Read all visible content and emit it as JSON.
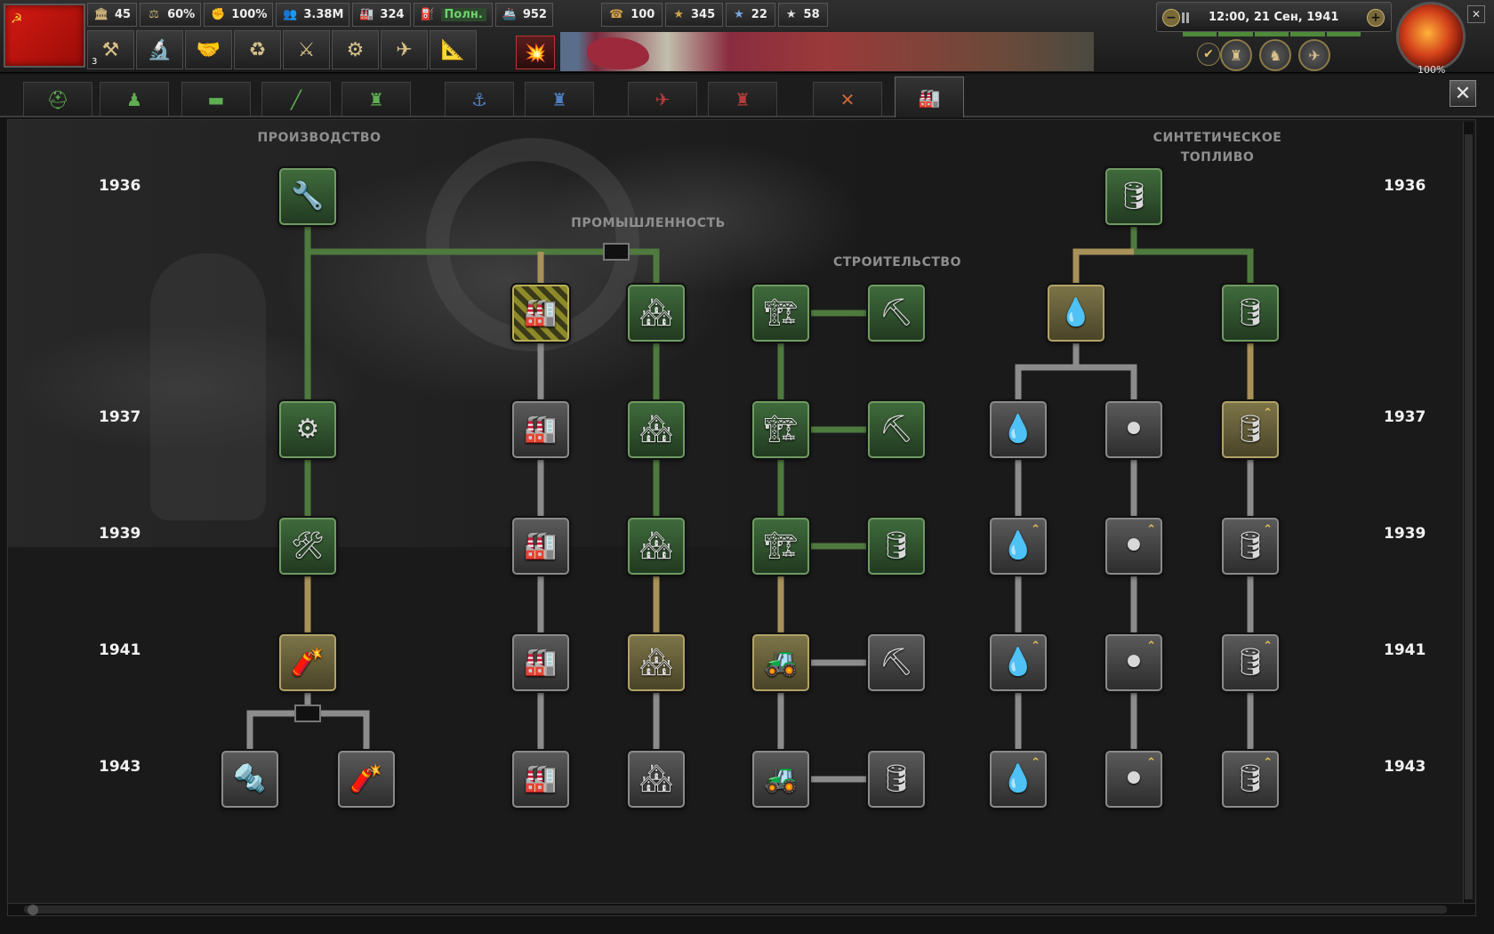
{
  "topbar": {
    "resources": [
      {
        "icon": "political-power-icon",
        "glyph": "🏛",
        "value": "45"
      },
      {
        "icon": "stability-icon",
        "glyph": "⚖",
        "value": "60%"
      },
      {
        "icon": "war-support-icon",
        "glyph": "✊",
        "value": "100%"
      },
      {
        "icon": "manpower-icon",
        "glyph": "👥",
        "value": "3.38M"
      },
      {
        "icon": "factories-icon",
        "glyph": "🏭",
        "value": "324"
      },
      {
        "icon": "fuel-icon",
        "glyph": "⛽",
        "value": "Полн."
      },
      {
        "icon": "convoys-icon",
        "glyph": "🚢",
        "value": "952"
      }
    ],
    "counters": [
      {
        "icon": "intel-icon",
        "glyph": "☎",
        "value": "100"
      },
      {
        "icon": "command-power-icon",
        "glyph": "★",
        "value": "345"
      },
      {
        "icon": "navy-xp-icon",
        "glyph": "★",
        "value": "22"
      },
      {
        "icon": "air-xp-icon",
        "glyph": "★",
        "value": "58"
      }
    ],
    "menu_buttons": [
      {
        "name": "decisions-button",
        "glyph": "⚒",
        "badge": "3"
      },
      {
        "name": "research-button",
        "glyph": "🔬",
        "badge": ""
      },
      {
        "name": "diplomacy-button",
        "glyph": "🤝",
        "badge": ""
      },
      {
        "name": "trade-button",
        "glyph": "♻",
        "badge": ""
      },
      {
        "name": "construction-button",
        "glyph": "⚔",
        "badge": ""
      },
      {
        "name": "production-button",
        "glyph": "⚙",
        "badge": ""
      },
      {
        "name": "logistics-button",
        "glyph": "✈",
        "badge": ""
      },
      {
        "name": "intelligence-button",
        "glyph": "📐",
        "badge": ""
      }
    ],
    "alert_glyph": "💥",
    "time": "12:00, 21 Сен, 1941",
    "speed_minus": "−",
    "speed_plus": "+",
    "round_buttons": [
      "♜",
      "♞",
      "✈"
    ],
    "check_glyph": "✔",
    "globe_label": "100%",
    "mini_close": "✕"
  },
  "tabs": [
    {
      "name": "tab-infantry",
      "glyph": "⛑",
      "color": "green",
      "active": false
    },
    {
      "name": "tab-support",
      "glyph": "♟",
      "color": "green",
      "active": false
    },
    {
      "name": "tab-armor",
      "glyph": "▬",
      "color": "green",
      "active": false
    },
    {
      "name": "tab-artillery",
      "glyph": "╱",
      "color": "green",
      "active": false
    },
    {
      "name": "tab-land-doctrine",
      "glyph": "♜",
      "color": "green",
      "active": false
    },
    {
      "name": "tab-naval",
      "glyph": "⚓",
      "color": "blue",
      "active": false
    },
    {
      "name": "tab-naval-doctrine",
      "glyph": "♜",
      "color": "blue",
      "active": false
    },
    {
      "name": "tab-air",
      "glyph": "✈",
      "color": "red",
      "active": false
    },
    {
      "name": "tab-air-doctrine",
      "glyph": "♜",
      "color": "red",
      "active": false
    },
    {
      "name": "tab-electronics",
      "glyph": "✕",
      "color": "orange",
      "active": false
    },
    {
      "name": "tab-industry",
      "glyph": "🏭",
      "color": "orange",
      "active": true
    }
  ],
  "close_label": "✕",
  "categories": {
    "production": "ПРОИЗВОДСТВО",
    "industry": "ПРОМЫШЛЕННОСТЬ",
    "construction": "СТРОИТЕЛЬСТВО",
    "synthetic_1": "СИНТЕТИЧЕСКОЕ",
    "synthetic_2": "ТОПЛИВО"
  },
  "years": {
    "y1936": "1936",
    "y1937": "1937",
    "y1939": "1939",
    "y1941": "1941",
    "y1943": "1943"
  },
  "tech_nodes": [
    {
      "id": "basic-machine-tools",
      "status": "researched",
      "glyph": "🔧"
    },
    {
      "id": "improved-machine-tools",
      "status": "researched",
      "glyph": "⚙"
    },
    {
      "id": "advanced-machine-tools",
      "status": "researched",
      "glyph": "🛠"
    },
    {
      "id": "assembly-line-production",
      "status": "inprogress",
      "glyph": "🧨"
    },
    {
      "id": "flexible-line",
      "status": "available",
      "glyph": "🔩"
    },
    {
      "id": "streamlined-line",
      "status": "available",
      "glyph": "🧨"
    },
    {
      "id": "concentrated-industry",
      "status": "hatched",
      "glyph": "🏭"
    },
    {
      "id": "concentrated-industry-2",
      "status": "available",
      "glyph": "🏭"
    },
    {
      "id": "concentrated-industry-3",
      "status": "available",
      "glyph": "🏭"
    },
    {
      "id": "concentrated-industry-4",
      "status": "available",
      "glyph": "🏭"
    },
    {
      "id": "concentrated-industry-5",
      "status": "available",
      "glyph": "🏭"
    },
    {
      "id": "dispersed-industry",
      "status": "researched",
      "glyph": "🏘"
    },
    {
      "id": "dispersed-industry-2",
      "status": "researched",
      "glyph": "🏘"
    },
    {
      "id": "dispersed-industry-3",
      "status": "researched",
      "glyph": "🏘"
    },
    {
      "id": "dispersed-industry-4",
      "status": "inprogress",
      "glyph": "🏘"
    },
    {
      "id": "dispersed-industry-5",
      "status": "available",
      "glyph": "🏘"
    },
    {
      "id": "construction-1",
      "status": "researched",
      "glyph": "🏗"
    },
    {
      "id": "construction-2",
      "status": "researched",
      "glyph": "🏗"
    },
    {
      "id": "construction-3",
      "status": "researched",
      "glyph": "🏗"
    },
    {
      "id": "construction-4",
      "status": "inprogress",
      "glyph": "🚜"
    },
    {
      "id": "construction-5",
      "status": "available",
      "glyph": "🚜"
    },
    {
      "id": "excavation-1",
      "status": "researched",
      "glyph": "⛏"
    },
    {
      "id": "excavation-2",
      "status": "researched",
      "glyph": "⛏"
    },
    {
      "id": "excavation-3",
      "status": "researched",
      "glyph": "🛢"
    },
    {
      "id": "excavation-4",
      "status": "available",
      "glyph": "⛏"
    },
    {
      "id": "excavation-5",
      "status": "available",
      "glyph": "🛢"
    },
    {
      "id": "fuel-storage",
      "status": "researched",
      "glyph": "🛢"
    },
    {
      "id": "synthetic-oil",
      "status": "inprogress",
      "glyph": "💧"
    },
    {
      "id": "fuel-refining",
      "status": "researched",
      "glyph": "🛢"
    },
    {
      "id": "oil-processing",
      "status": "available",
      "glyph": "💧"
    },
    {
      "id": "rubber-processing",
      "status": "available",
      "glyph": "⚫"
    },
    {
      "id": "fuel-refining-2",
      "status": "inprogress",
      "glyph": "🛢"
    },
    {
      "id": "oil-processing-2",
      "status": "available",
      "glyph": "💧"
    },
    {
      "id": "rubber-processing-2",
      "status": "available",
      "glyph": "⚫"
    },
    {
      "id": "fuel-refining-3",
      "status": "available",
      "glyph": "🛢"
    },
    {
      "id": "oil-processing-3",
      "status": "available",
      "glyph": "💧"
    },
    {
      "id": "rubber-processing-3",
      "status": "available",
      "glyph": "⚫"
    },
    {
      "id": "fuel-refining-4",
      "status": "available",
      "glyph": "🛢"
    },
    {
      "id": "oil-processing-4",
      "status": "available",
      "glyph": "💧"
    },
    {
      "id": "rubber-processing-4",
      "status": "available",
      "glyph": "⚫"
    },
    {
      "id": "fuel-refining-5",
      "status": "available",
      "glyph": "🛢"
    }
  ]
}
